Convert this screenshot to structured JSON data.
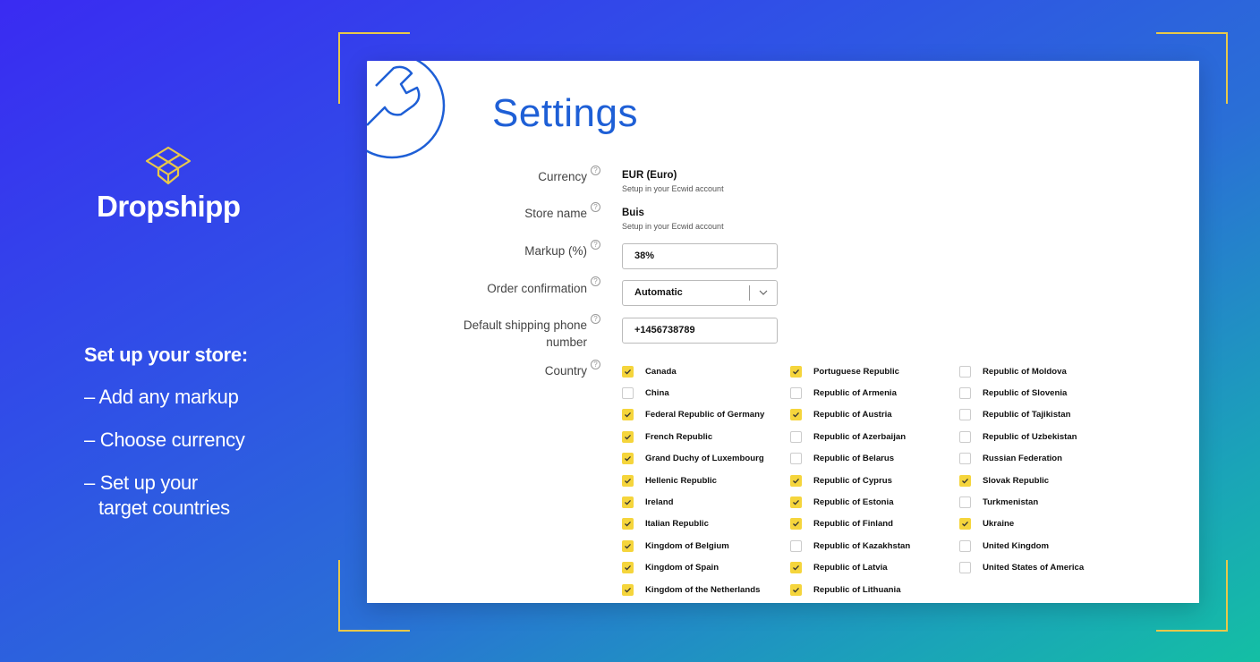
{
  "brand": {
    "name": "Dropshipp",
    "logo_icon": "box-outline-icon",
    "accent": "#e8c84a"
  },
  "promo": {
    "heading": "Set up your store:",
    "items": [
      "– Add any markup",
      "– Choose currency",
      "– Set up your"
    ],
    "item3_line2": "target countries"
  },
  "settings": {
    "title": "Settings",
    "currency": {
      "label": "Currency",
      "value": "EUR (Euro)",
      "note": "Setup in your Ecwid account"
    },
    "store_name": {
      "label": "Store name",
      "value": "Buis",
      "note": "Setup in your Ecwid account"
    },
    "markup": {
      "label": "Markup (%)",
      "value": "38%"
    },
    "order_confirmation": {
      "label": "Order confirmation",
      "value": "Automatic"
    },
    "phone": {
      "label_line1": "Default shipping phone",
      "label_line2": "number",
      "value": "+1456738789"
    },
    "country": {
      "label": "Country",
      "columns": [
        [
          {
            "name": "Canada",
            "checked": true
          },
          {
            "name": "China",
            "checked": false
          },
          {
            "name": "Federal Republic of Germany",
            "checked": true
          },
          {
            "name": "French Republic",
            "checked": true
          },
          {
            "name": "Grand Duchy of Luxembourg",
            "checked": true
          },
          {
            "name": "Hellenic Republic",
            "checked": true
          },
          {
            "name": "Ireland",
            "checked": true
          },
          {
            "name": "Italian Republic",
            "checked": true
          },
          {
            "name": "Kingdom of Belgium",
            "checked": true
          },
          {
            "name": "Kingdom of Spain",
            "checked": true
          },
          {
            "name": "Kingdom of the Netherlands",
            "checked": true
          }
        ],
        [
          {
            "name": "Portuguese Republic",
            "checked": true
          },
          {
            "name": "Republic of Armenia",
            "checked": false
          },
          {
            "name": "Republic of Austria",
            "checked": true
          },
          {
            "name": "Republic of Azerbaijan",
            "checked": false
          },
          {
            "name": "Republic of Belarus",
            "checked": false
          },
          {
            "name": "Republic of Cyprus",
            "checked": true
          },
          {
            "name": "Republic of Estonia",
            "checked": true
          },
          {
            "name": "Republic of Finland",
            "checked": true
          },
          {
            "name": "Republic of Kazakhstan",
            "checked": false
          },
          {
            "name": "Republic of Latvia",
            "checked": true
          },
          {
            "name": "Republic of Lithuania",
            "checked": true
          }
        ],
        [
          {
            "name": "Republic of Moldova",
            "checked": false
          },
          {
            "name": "Republic of Slovenia",
            "checked": false
          },
          {
            "name": "Republic of Tajikistan",
            "checked": false
          },
          {
            "name": "Republic of Uzbekistan",
            "checked": false
          },
          {
            "name": "Russian Federation",
            "checked": false
          },
          {
            "name": "Slovak Republic",
            "checked": true
          },
          {
            "name": "Turkmenistan",
            "checked": false
          },
          {
            "name": "Ukraine",
            "checked": true
          },
          {
            "name": "United Kingdom",
            "checked": false
          },
          {
            "name": "United States of America",
            "checked": false
          }
        ]
      ]
    }
  },
  "colors": {
    "title_blue": "#1e5fd6",
    "checkbox_yellow": "#f5d53c"
  }
}
